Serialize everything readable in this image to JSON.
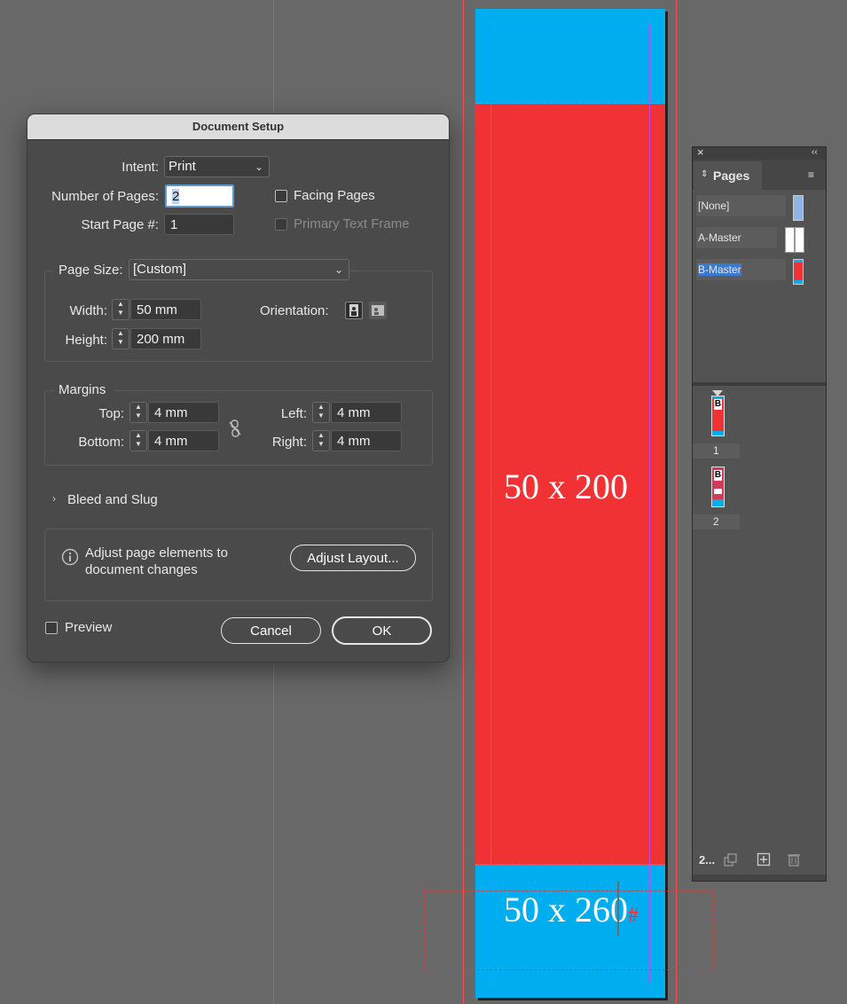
{
  "canvas": {
    "page_text_top": "50 x 200",
    "page_text_bottom": "50 x 260",
    "colors": {
      "cyan": "#00adef",
      "red": "#f03234",
      "guide": "#ff4d4d",
      "margin": "#b54cff"
    }
  },
  "dialog": {
    "title": "Document Setup",
    "intent_label": "Intent:",
    "intent_value": "Print",
    "num_pages_label": "Number of Pages:",
    "num_pages_value": "2",
    "start_page_label": "Start Page #:",
    "start_page_value": "1",
    "facing_pages_label": "Facing Pages",
    "primary_text_frame_label": "Primary Text Frame",
    "page_size_label": "Page Size:",
    "page_size_value": "[Custom]",
    "width_label": "Width:",
    "width_value": "50 mm",
    "height_label": "Height:",
    "height_value": "200 mm",
    "orientation_label": "Orientation:",
    "margins_label": "Margins",
    "top_label": "Top:",
    "top_value": "4 mm",
    "bottom_label": "Bottom:",
    "bottom_value": "4 mm",
    "left_label": "Left:",
    "left_value": "4 mm",
    "right_label": "Right:",
    "right_value": "4 mm",
    "bleed_slug_label": "Bleed and Slug",
    "adjust_line1": "Adjust page elements to",
    "adjust_line2": "document changes",
    "adjust_button": "Adjust Layout...",
    "preview_label": "Preview",
    "cancel_button": "Cancel",
    "ok_button": "OK"
  },
  "pages_panel": {
    "tab_label": "Pages",
    "masters": [
      {
        "label": "[None]"
      },
      {
        "label": "A-Master"
      },
      {
        "label": "B-Master"
      }
    ],
    "pages": [
      {
        "number": "1",
        "master_letter": "B"
      },
      {
        "number": "2",
        "master_letter": "B"
      }
    ],
    "footer_count": "2..."
  }
}
